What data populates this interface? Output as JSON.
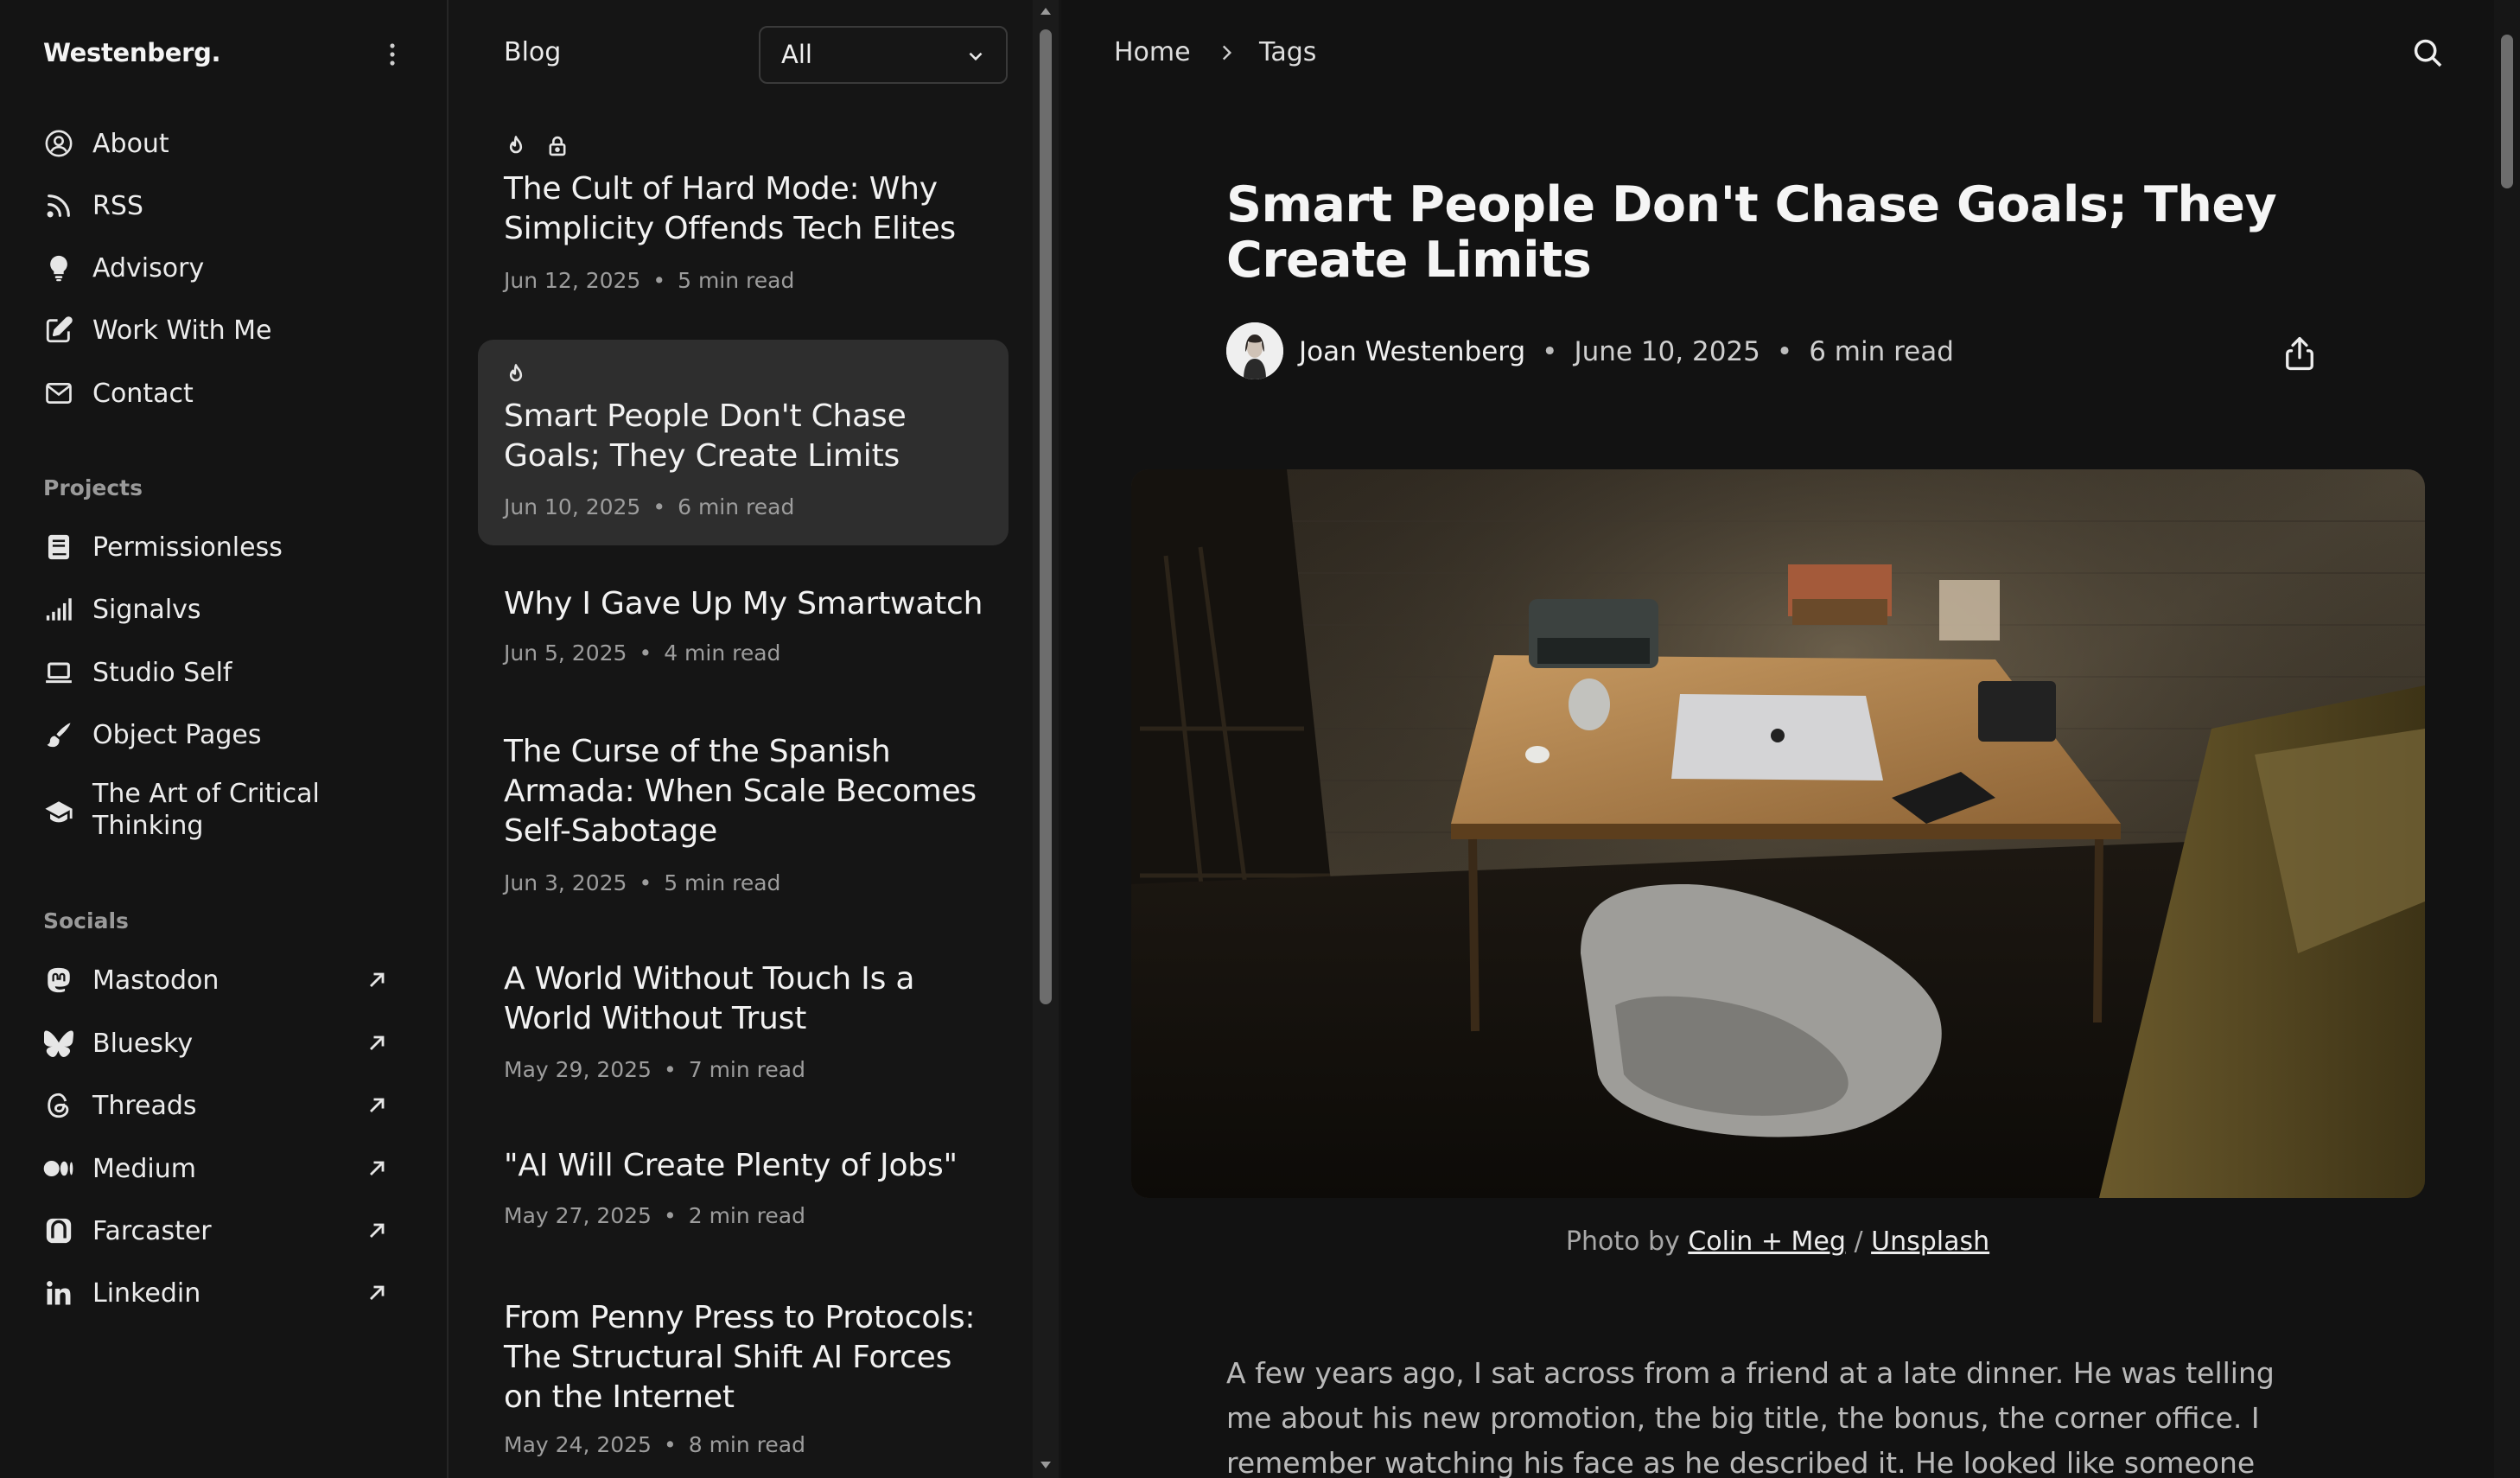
{
  "sidebar": {
    "brand": "Westenberg.",
    "nav": [
      {
        "label": "About",
        "icon": "user-circle-icon"
      },
      {
        "label": "RSS",
        "icon": "rss-icon"
      },
      {
        "label": "Advisory",
        "icon": "lightbulb-icon"
      },
      {
        "label": "Work With Me",
        "icon": "edit-icon"
      },
      {
        "label": "Contact",
        "icon": "mail-icon"
      }
    ],
    "projects_heading": "Projects",
    "projects": [
      {
        "label": "Permissionless",
        "icon": "book-icon"
      },
      {
        "label": "Signalvs",
        "icon": "signal-icon"
      },
      {
        "label": "Studio Self",
        "icon": "laptop-icon"
      },
      {
        "label": "Object Pages",
        "icon": "brush-icon"
      },
      {
        "label": "The Art of Critical Thinking",
        "icon": "graduation-cap-icon"
      }
    ],
    "socials_heading": "Socials",
    "socials": [
      {
        "label": "Mastodon",
        "icon": "mastodon-icon"
      },
      {
        "label": "Bluesky",
        "icon": "bluesky-icon"
      },
      {
        "label": "Threads",
        "icon": "threads-icon"
      },
      {
        "label": "Medium",
        "icon": "medium-icon"
      },
      {
        "label": "Farcaster",
        "icon": "farcaster-icon"
      },
      {
        "label": "Linkedin",
        "icon": "linkedin-icon"
      }
    ]
  },
  "list": {
    "title": "Blog",
    "filter_value": "All",
    "posts": [
      {
        "title": "The Cult of Hard Mode: Why Simplicity Offends Tech Elites",
        "date": "Jun 12, 2025",
        "read": "5 min read",
        "badges": [
          "fire-icon",
          "lock-icon"
        ]
      },
      {
        "title": "Smart People Don't Chase Goals; They Create Limits",
        "date": "Jun 10, 2025",
        "read": "6 min read",
        "badges": [
          "fire-icon"
        ],
        "active": true
      },
      {
        "title": "Why I Gave Up My Smartwatch",
        "date": "Jun 5, 2025",
        "read": "4 min read"
      },
      {
        "title": "The Curse of the Spanish Armada: When Scale Becomes Self-Sabotage",
        "date": "Jun 3, 2025",
        "read": "5 min read"
      },
      {
        "title": "A World Without Touch Is a World Without Trust",
        "date": "May 29, 2025",
        "read": "7 min read"
      },
      {
        "title": "\"AI Will Create Plenty of Jobs\"",
        "date": "May 27, 2025",
        "read": "2 min read"
      },
      {
        "title": "From Penny Press to Protocols: The Structural Shift AI Forces on the Internet",
        "date": "May 24, 2025",
        "read": "8 min read"
      }
    ]
  },
  "article": {
    "breadcrumb": [
      "Home",
      "Tags"
    ],
    "title": "Smart People Don't Chase Goals; They Create Limits",
    "author": "Joan Westenberg",
    "date": "June 10, 2025",
    "read": "6 min read",
    "caption_prefix": "Photo by",
    "caption_author": "Colin + Meg",
    "caption_sep": "/",
    "caption_source": "Unsplash",
    "body": "A few years ago, I sat across from a friend at a late dinner. He was telling me about his new promotion, the big title, the bonus, the corner office. I remember watching his face as he described it. He looked like someone describing a"
  },
  "colors": {
    "background": "#151515",
    "active_post": "#2e2e2e",
    "text": "#ededed",
    "muted": "#9d9d9d"
  }
}
